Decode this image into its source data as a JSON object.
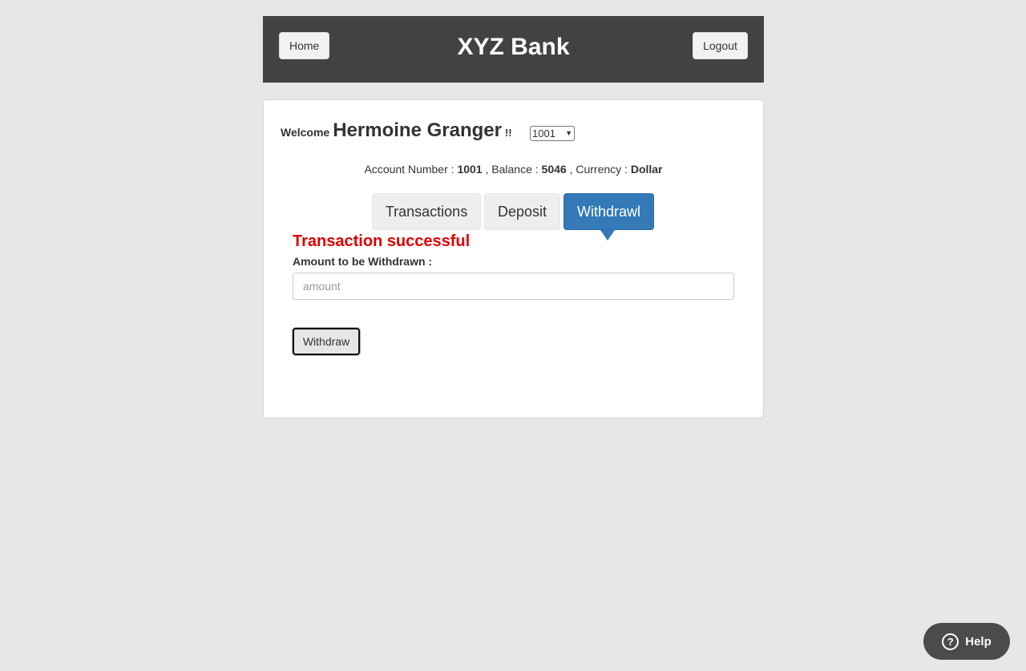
{
  "header": {
    "home_label": "Home",
    "title": "XYZ Bank",
    "logout_label": "Logout"
  },
  "welcome": {
    "prefix": "Welcome",
    "customer_name": "Hermoine Granger",
    "suffix": "!!",
    "selected_account": "1001"
  },
  "account_info": {
    "number_label": "Account Number :",
    "number": "1001",
    "balance_label": ", Balance :",
    "balance": "5046",
    "currency_label": ", Currency :",
    "currency": "Dollar"
  },
  "tabs": [
    {
      "label": "Transactions"
    },
    {
      "label": "Deposit"
    },
    {
      "label": "Withdrawl",
      "active": true
    }
  ],
  "withdraw_form": {
    "status_message": "Transaction successful",
    "amount_label": "Amount to be Withdrawn :",
    "amount_value": "",
    "amount_placeholder": "amount",
    "submit_label": "Withdraw"
  },
  "help": {
    "icon": "question-circle-icon",
    "label": "Help"
  },
  "colors": {
    "header_bg": "#424242",
    "active_tab": "#337ab7",
    "success_text": "#e00000",
    "page_bg": "#e7e7e7"
  }
}
